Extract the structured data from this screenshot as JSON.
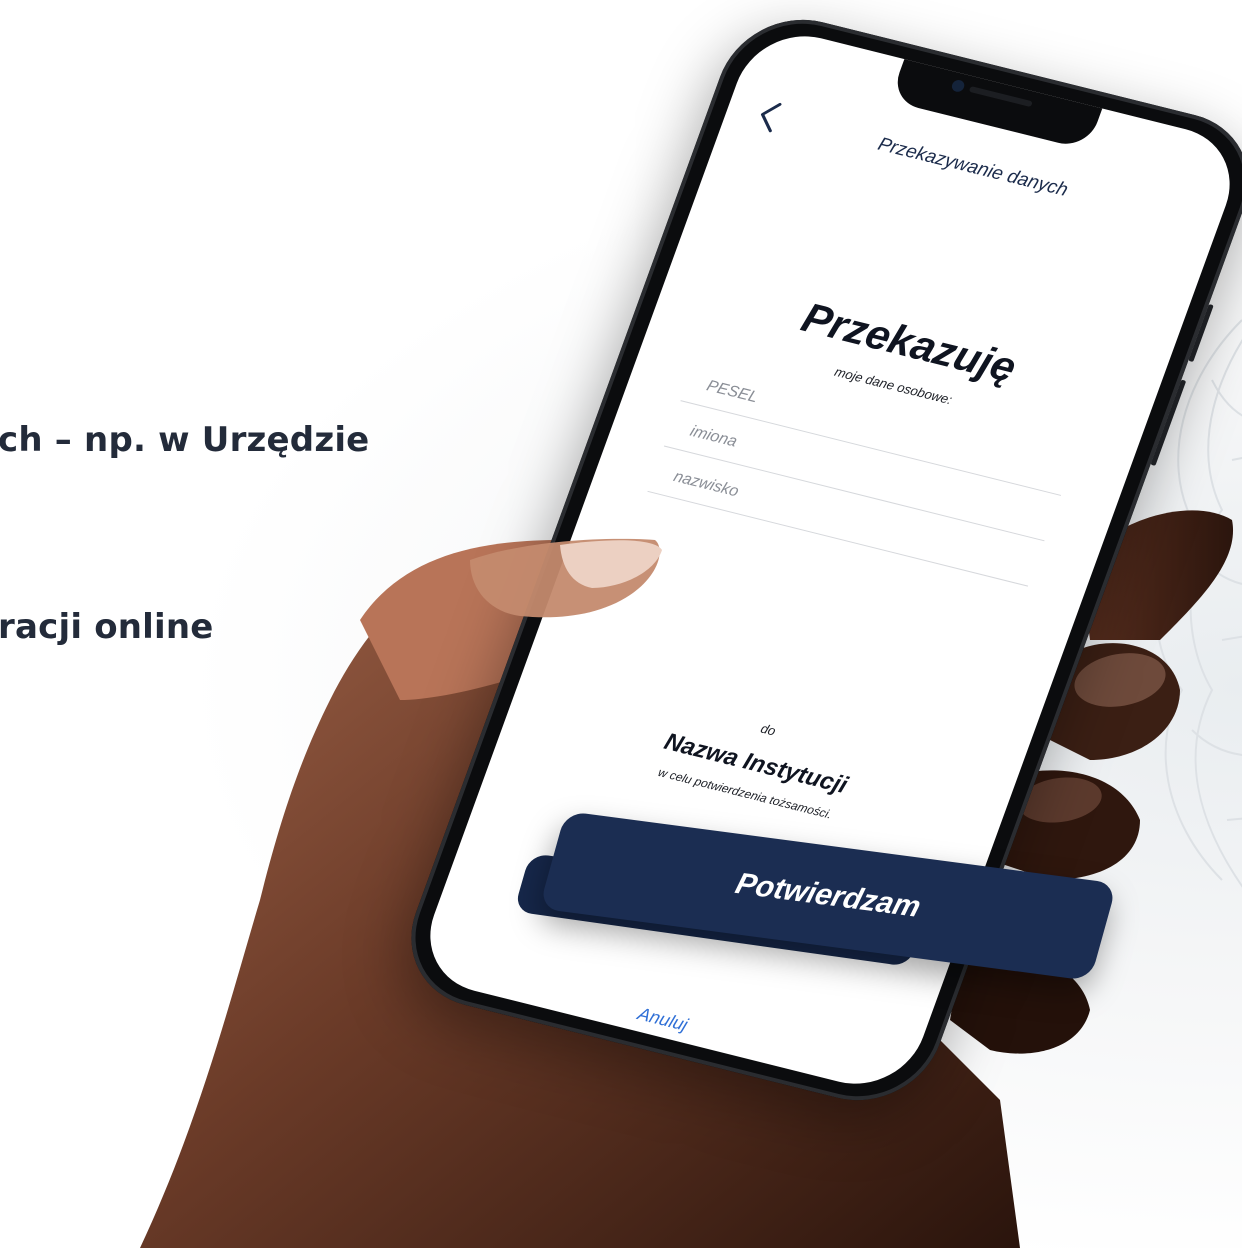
{
  "background_text": {
    "line1": "ch – np. w Urzędzie",
    "line2": "racji online"
  },
  "app": {
    "nav_title": "Przekazywanie danych",
    "back_icon": "chevron-left-icon",
    "title": "Przekazuję",
    "subtitle": "moje dane osobowe:",
    "fields": {
      "pesel_placeholder": "PESEL",
      "names_placeholder": "imiona",
      "surname_placeholder": "nazwisko"
    },
    "to_label": "do",
    "institution": "Nazwa Instytucji",
    "purpose": "w celu potwierdzenia tożsamości.",
    "confirm_label": "Potwierdzam",
    "cancel_label": "Anuluj"
  },
  "colors": {
    "navy": "#1b2d52",
    "link": "#2f6fd6",
    "text_dark": "#232b3a"
  }
}
